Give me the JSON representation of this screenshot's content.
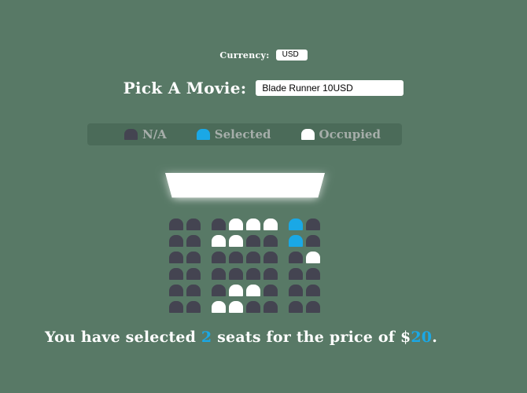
{
  "currency": {
    "label": "Currency:",
    "selected": "USD"
  },
  "movie": {
    "label": "Pick A Movie:",
    "selected": "Blade Runner 10USD"
  },
  "legend": {
    "items": [
      {
        "label": "N/A",
        "color": "#444451"
      },
      {
        "label": "Selected",
        "color": "#1aa8e6"
      },
      {
        "label": "Occupied",
        "color": "#ffffff"
      }
    ]
  },
  "seats": {
    "rows": [
      [
        "na",
        "na",
        "na",
        "occupied",
        "occupied",
        "occupied",
        "selected",
        "na"
      ],
      [
        "na",
        "na",
        "occupied",
        "occupied",
        "na",
        "na",
        "selected",
        "na"
      ],
      [
        "na",
        "na",
        "na",
        "na",
        "na",
        "na",
        "na",
        "occupied"
      ],
      [
        "na",
        "na",
        "na",
        "na",
        "na",
        "na",
        "na",
        "na"
      ],
      [
        "na",
        "na",
        "na",
        "occupied",
        "occupied",
        "na",
        "na",
        "na"
      ],
      [
        "na",
        "na",
        "occupied",
        "occupied",
        "na",
        "na",
        "na",
        "na"
      ]
    ]
  },
  "summary": {
    "prefix": "You have selected ",
    "count": "2",
    "middle": " seats for the price of $",
    "price": "20",
    "suffix": "."
  },
  "colors": {
    "background": "#587966",
    "accent": "#1aa8e6"
  }
}
